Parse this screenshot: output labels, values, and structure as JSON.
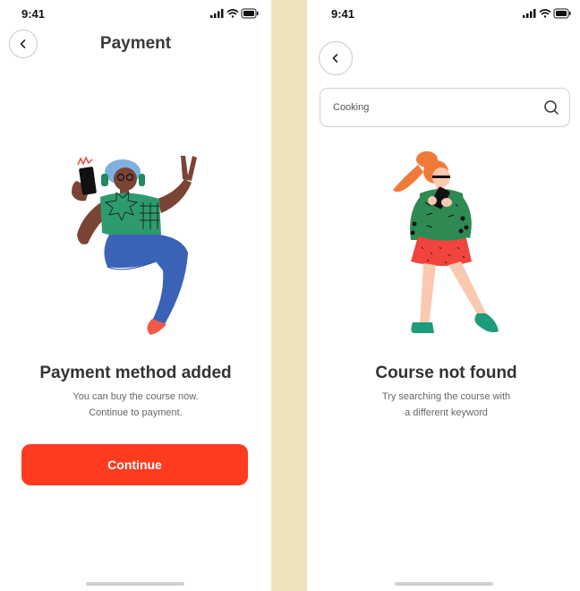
{
  "left_screen": {
    "status": {
      "time": "9:41"
    },
    "header": {
      "title": "Payment"
    },
    "heading": "Payment method added",
    "subtext": [
      "You can buy the course now.",
      "Continue to payment."
    ],
    "continue_label": "Continue"
  },
  "right_screen": {
    "status": {
      "time": "9:41"
    },
    "search": {
      "value": "Cooking"
    },
    "heading": "Course not found",
    "subtext": [
      "Try searching the course with",
      "a different keyword"
    ]
  },
  "colors": {
    "accent": "#ff3b1f",
    "background": "#ede3bd"
  },
  "icons": [
    "back-chevron-icon",
    "search-icon",
    "signal-icon",
    "wifi-icon",
    "battery-icon"
  ]
}
